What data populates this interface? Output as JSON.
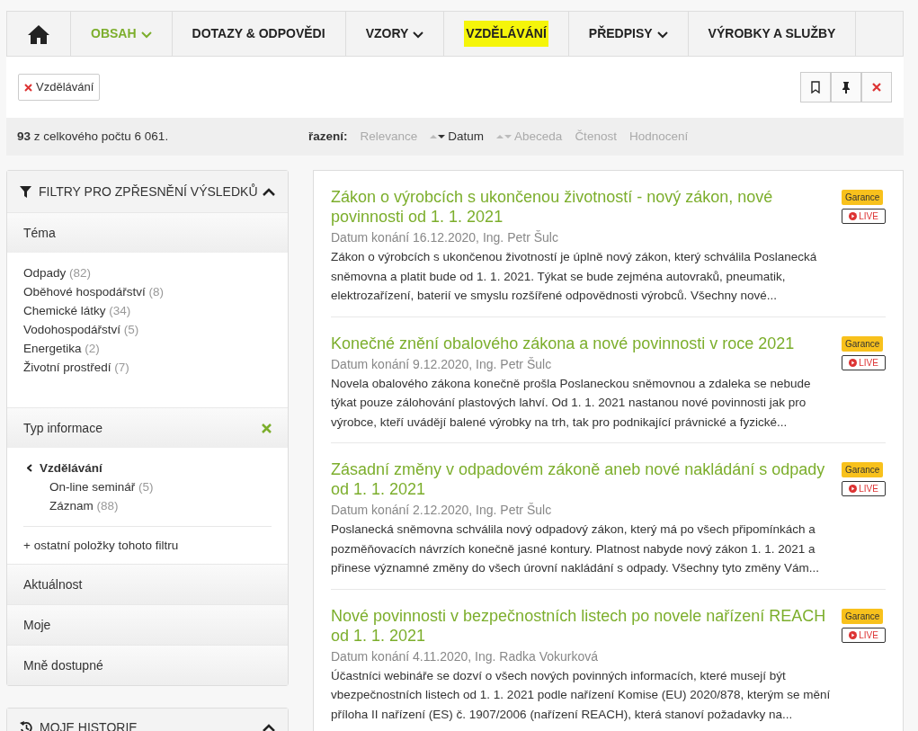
{
  "nav": {
    "items": [
      {
        "label": "OBSAH",
        "selected": true,
        "dropdown": true,
        "highlighted": false
      },
      {
        "label": "DOTAZY & ODPOVĚDI",
        "selected": false,
        "dropdown": false,
        "highlighted": false
      },
      {
        "label": "VZORY",
        "selected": false,
        "dropdown": true,
        "highlighted": false
      },
      {
        "label": "VZDĚLÁVÁNÍ",
        "selected": false,
        "dropdown": false,
        "highlighted": true
      },
      {
        "label": "PŘEDPISY",
        "selected": false,
        "dropdown": true,
        "highlighted": false
      },
      {
        "label": "VÝROBKY A SLUŽBY",
        "selected": false,
        "dropdown": false,
        "highlighted": false
      }
    ]
  },
  "active_filters": [
    {
      "label": "Vzdělávání"
    }
  ],
  "summary": {
    "count": "93",
    "text": "z celkového počtu 6 061."
  },
  "sort": {
    "label": "řazení:",
    "options": [
      {
        "label": "Relevance",
        "selected": false,
        "kind": "plain"
      },
      {
        "label": "Datum",
        "selected": true,
        "kind": "sortable"
      },
      {
        "label": "Abeceda",
        "selected": false,
        "kind": "sortable"
      },
      {
        "label": "Čtenost",
        "selected": false,
        "kind": "plain"
      },
      {
        "label": "Hodnocení",
        "selected": false,
        "kind": "plain"
      }
    ]
  },
  "filter_panel": {
    "title": "FILTRY PRO ZPŘESNĚNÍ VÝSLEDKŮ",
    "expanded": true,
    "sections": [
      {
        "title": "Téma",
        "expanded": true,
        "clearable": false,
        "items": [
          {
            "label": "Odpady",
            "count": "(82)"
          },
          {
            "label": "Oběhové hospodářství",
            "count": "(8)"
          },
          {
            "label": "Chemické látky",
            "count": "(34)"
          },
          {
            "label": "Vodohospodářství",
            "count": "(5)"
          },
          {
            "label": "Energetika",
            "count": "(2)"
          },
          {
            "label": "Životní prostředí",
            "count": "(7)"
          }
        ]
      },
      {
        "title": "Typ informace",
        "expanded": true,
        "clearable": true,
        "items": [
          {
            "label": "Vzdělávání",
            "children": [
              {
                "label": "On-line seminář",
                "count": "(5)"
              },
              {
                "label": "Záznam",
                "count": "(88)"
              }
            ]
          }
        ],
        "more": "+ ostatní položky tohoto filtru"
      },
      {
        "title": "Aktuálnost",
        "expanded": false,
        "clearable": false
      },
      {
        "title": "Moje",
        "expanded": false,
        "clearable": false
      },
      {
        "title": "Mně dostupné",
        "expanded": false,
        "clearable": false
      }
    ]
  },
  "history_panel": {
    "title": "MOJE HISTORIE",
    "expanded": true
  },
  "results": [
    {
      "title": "Zákon o výrobcích s ukončenou životností - nový zákon, nové povinnosti od 1. 1. 2021",
      "meta": "Datum konání 16.12.2020, Ing. Petr Šulc",
      "text": "Zákon o výrobcích s ukončenou životností je úplně nový zákon, který schválila Poslanecká sněmovna a platit bude od 1. 1. 2021. Týkat se bude zejména autovraků, pneumatik, elektrozařízení, baterií ve smyslu rozšířené odpovědnosti výrobců. Všechny nové...",
      "badges": [
        {
          "label": "Garance",
          "kind": "tag"
        },
        {
          "label": "LIVE",
          "kind": "live"
        }
      ]
    },
    {
      "title": "Konečné znění obalového zákona a nové povinnosti v roce 2021",
      "meta": "Datum konání 9.12.2020, Ing. Petr Šulc",
      "text": "Novela obalového zákona konečně prošla Poslaneckou sněmovnou a zdaleka se nebude týkat pouze zálohování plastových lahví. Od 1. 1. 2021 nastanou nové povinnosti jak pro výrobce, kteří uvádějí balené výrobky na trh, tak pro podnikající právnické a fyzické...",
      "badges": [
        {
          "label": "Garance",
          "kind": "tag"
        },
        {
          "label": "LIVE",
          "kind": "live"
        }
      ]
    },
    {
      "title": "Zásadní změny v odpadovém zákoně aneb nové nakládání s odpady od 1. 1. 2021",
      "meta": "Datum konání 2.12.2020, Ing. Petr Šulc",
      "text": "Poslanecká sněmovna schválila nový odpadový zákon, který má po všech připomínkách a pozměňovacích návrzích konečně jasné kontury. Platnost nabyde nový zákon 1. 1. 2021 a přinese významné změny do všech úrovní nakládání s odpady. Všechny tyto změny Vám...",
      "badges": [
        {
          "label": "Garance",
          "kind": "tag"
        },
        {
          "label": "LIVE",
          "kind": "live"
        }
      ]
    },
    {
      "title": "Nové povinnosti v bezpečnostních listech po novele nařízení REACH od 1. 1. 2021",
      "meta": "Datum konání 4.11.2020, Ing. Radka Vokurková",
      "text": "Účastníci webináře se dozví o všech nových povinných informacích, které musejí být vbezpečnostních listech od 1. 1. 2021 podle nařízení Komise (EU) 2020/878, kterým se mění příloha II nařízení (ES) č. 1907/2006 (nařízení REACH), která stanoví požadavky na...",
      "badges": [
        {
          "label": "Garance",
          "kind": "tag"
        },
        {
          "label": "LIVE",
          "kind": "live"
        }
      ]
    }
  ]
}
